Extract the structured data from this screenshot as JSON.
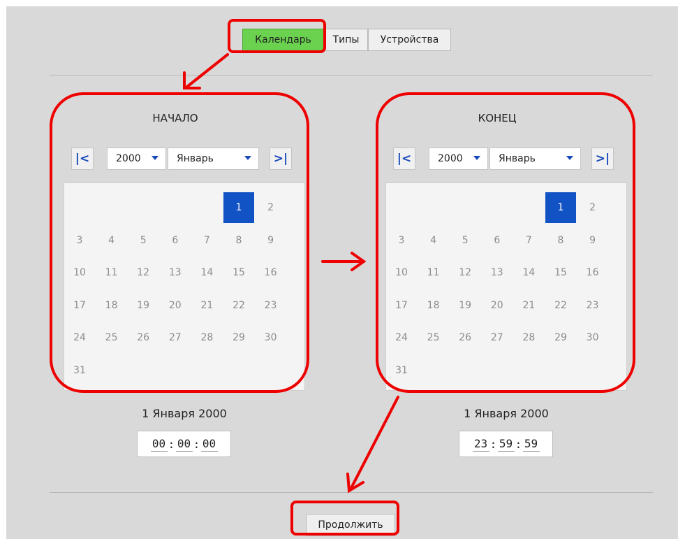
{
  "tabs": [
    {
      "label": "Календарь",
      "active": true
    },
    {
      "label": "Типы",
      "active": false
    },
    {
      "label": "Устройства",
      "active": false
    }
  ],
  "start": {
    "title": "НАЧАЛО",
    "year": "2000",
    "month": "Январь",
    "prev_icon": "|<",
    "next_icon": ">|",
    "days": [
      "1",
      "2",
      "3",
      "4",
      "5",
      "6",
      "7",
      "8",
      "9",
      "10",
      "11",
      "12",
      "13",
      "14",
      "15",
      "16",
      "17",
      "18",
      "19",
      "20",
      "21",
      "22",
      "23",
      "24",
      "25",
      "26",
      "27",
      "28",
      "29",
      "30",
      "31"
    ],
    "selected_day": "1",
    "date_text": "1 Января 2000",
    "time": {
      "h": "00",
      "m": "00",
      "s": "00"
    }
  },
  "end": {
    "title": "КОНЕЦ",
    "year": "2000",
    "month": "Январь",
    "prev_icon": "|<",
    "next_icon": ">|",
    "days": [
      "1",
      "2",
      "3",
      "4",
      "5",
      "6",
      "7",
      "8",
      "9",
      "10",
      "11",
      "12",
      "13",
      "14",
      "15",
      "16",
      "17",
      "18",
      "19",
      "20",
      "21",
      "22",
      "23",
      "24",
      "25",
      "26",
      "27",
      "28",
      "29",
      "30",
      "31"
    ],
    "selected_day": "1",
    "date_text": "1 Января 2000",
    "time": {
      "h": "23",
      "m": "59",
      "s": "59"
    }
  },
  "continue_label": "Продолжить",
  "time_separator": ":",
  "colors": {
    "active_tab": "#6ad24e",
    "selected_day": "#1152c4",
    "nav_icon": "#1749b9",
    "annotation": "#ee0000"
  }
}
